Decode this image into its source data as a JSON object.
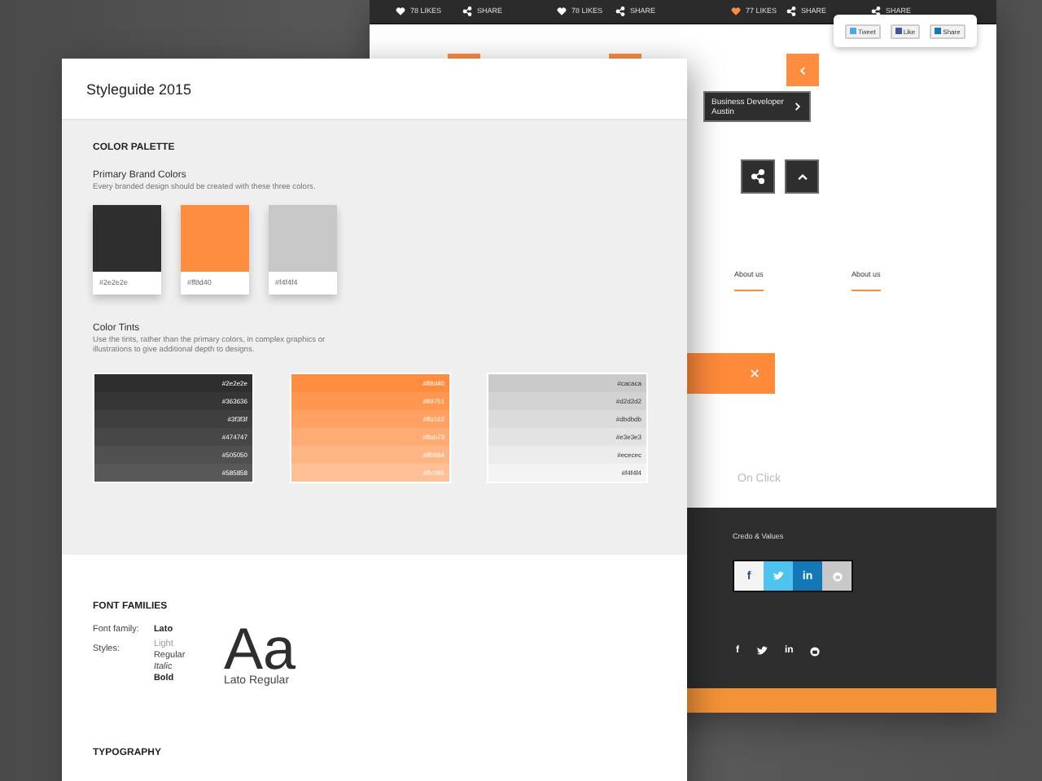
{
  "background_page": {
    "top_bar": [
      {
        "kind": "like",
        "label": "78 LIKES",
        "liked": false
      },
      {
        "kind": "share",
        "label": "SHARE"
      },
      {
        "kind": "like",
        "label": "78 LIKES",
        "liked": false
      },
      {
        "kind": "share",
        "label": "SHARE"
      },
      {
        "kind": "like",
        "label": "77 LIKES",
        "liked": true
      },
      {
        "kind": "share",
        "label": "SHARE"
      },
      {
        "kind": "share",
        "label": "SHARE"
      }
    ],
    "share_popup": [
      {
        "kind": "twitter",
        "label": "Tweet"
      },
      {
        "kind": "facebook",
        "label": "Like"
      },
      {
        "kind": "linkedin",
        "label": "Share"
      }
    ],
    "tooltip": {
      "title": "Business Developer",
      "subtitle": "Austin"
    },
    "tabs": [
      "About us",
      "About us"
    ],
    "on_click": "On Click",
    "footer": {
      "title": "Credo & Values",
      "social_buttons": [
        {
          "kind": "facebook",
          "label": "f"
        },
        {
          "kind": "twitter"
        },
        {
          "kind": "linkedin",
          "label": "in"
        },
        {
          "kind": "other"
        }
      ],
      "social_icons": [
        {
          "kind": "facebook",
          "label": "f"
        },
        {
          "kind": "twitter"
        },
        {
          "kind": "linkedin",
          "label": "in"
        },
        {
          "kind": "other"
        }
      ]
    }
  },
  "styleguide": {
    "title": "Styleguide 2015",
    "color_palette": {
      "heading": "COLOR PALETTE",
      "primary": {
        "title": "Primary Brand Colors",
        "description": "Every branded design should be created with these three colors.",
        "swatches": [
          {
            "label": "#2e2e2e",
            "color": "#2e2e2e"
          },
          {
            "label": "#ff8d40",
            "color": "#ff8d40"
          },
          {
            "label": "#f4f4f4",
            "color": "#c8c8c8"
          }
        ]
      },
      "tints": {
        "title": "Color Tints",
        "description": "Use the tints, rather than the primary colors, in complex graphics or illustrations to give additional depth to designs.",
        "groups": [
          [
            {
              "label": "#2e2e2e",
              "color": "#2e2e2e"
            },
            {
              "label": "#363636",
              "color": "#363636"
            },
            {
              "label": "#3f3f3f",
              "color": "#3f3f3f"
            },
            {
              "label": "#474747",
              "color": "#474747"
            },
            {
              "label": "#505050",
              "color": "#505050"
            },
            {
              "label": "#585858",
              "color": "#585858"
            }
          ],
          [
            {
              "label": "#ff8d40",
              "color": "#ff8d40"
            },
            {
              "label": "#ff9751",
              "color": "#ff9751"
            },
            {
              "label": "#ffa162",
              "color": "#ffa162"
            },
            {
              "label": "#ffab73",
              "color": "#ffab73"
            },
            {
              "label": "#ffb684",
              "color": "#ffb684"
            },
            {
              "label": "#ffc095",
              "color": "#ffc095"
            }
          ],
          [
            {
              "label": "#cacaca",
              "color": "#cacaca"
            },
            {
              "label": "#d2d2d2",
              "color": "#d2d2d2"
            },
            {
              "label": "#dbdbdb",
              "color": "#dbdbdb"
            },
            {
              "label": "#e3e3e3",
              "color": "#e3e3e3"
            },
            {
              "label": "#ececec",
              "color": "#ececec"
            },
            {
              "label": "#f4f4f4",
              "color": "#f4f4f4"
            }
          ]
        ]
      }
    },
    "font_families": {
      "heading": "FONT FAMILIES",
      "family_label": "Font family:",
      "family": "Lato",
      "styles_label": "Styles:",
      "styles": [
        {
          "kind": "light",
          "label": "Light"
        },
        {
          "kind": "regular",
          "label": "Regular"
        },
        {
          "kind": "italic",
          "label": "Italic"
        },
        {
          "kind": "bold",
          "label": "Bold"
        }
      ],
      "sample": "Aa",
      "sample_caption": "Lato Regular"
    },
    "typography": {
      "heading": "TYPOGRAPHY"
    }
  }
}
